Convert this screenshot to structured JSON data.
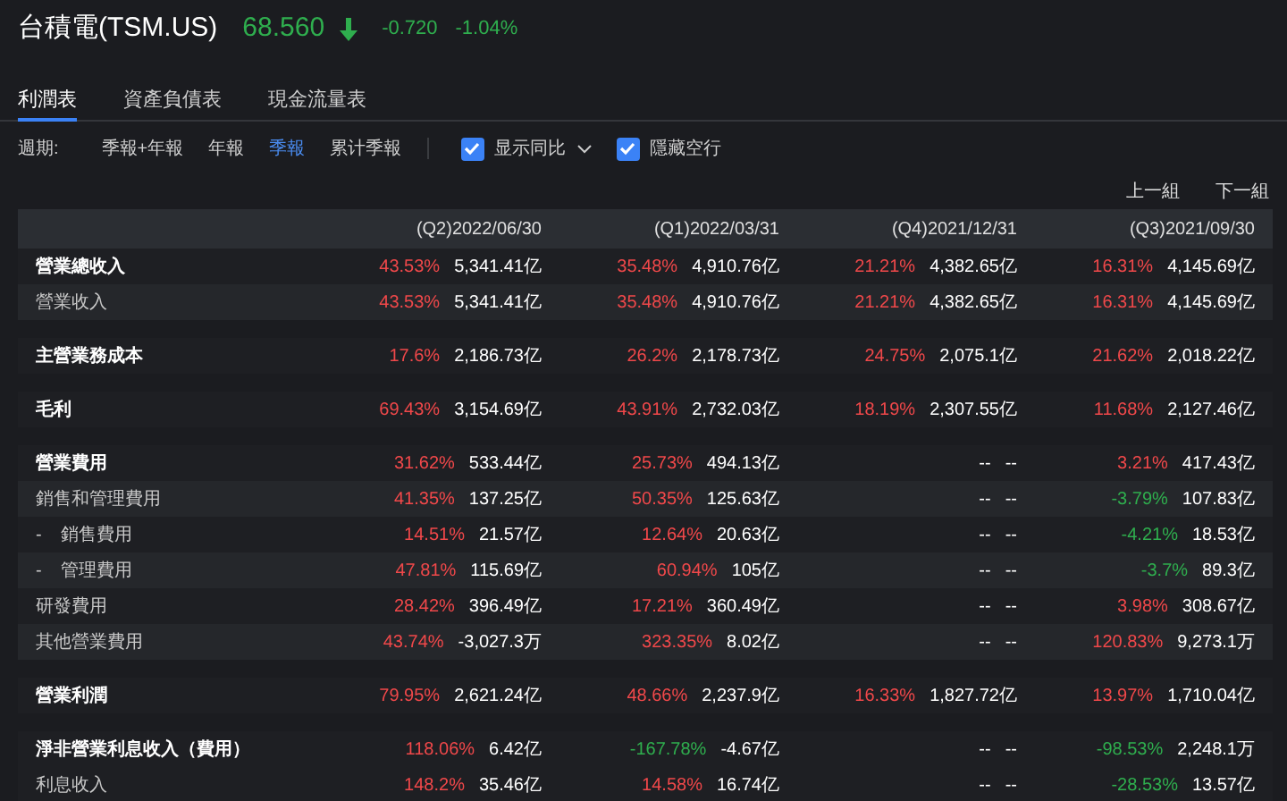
{
  "quote": {
    "name": "台積電(TSM.US)",
    "price": "68.560",
    "down": true,
    "change": "-0.720",
    "change_pct": "-1.04%"
  },
  "tabs": [
    {
      "label": "利潤表",
      "selected": true
    },
    {
      "label": "資產負債表",
      "selected": false
    },
    {
      "label": "現金流量表",
      "selected": false
    }
  ],
  "period": {
    "label": "週期:",
    "options": [
      {
        "label": "季報+年報",
        "selected": false
      },
      {
        "label": "年報",
        "selected": false
      },
      {
        "label": "季報",
        "selected": true
      },
      {
        "label": "累计季報",
        "selected": false
      }
    ]
  },
  "toggles": [
    {
      "label": "显示同比",
      "checked": true,
      "dropdown": true
    },
    {
      "label": "隱藏空行",
      "checked": true,
      "dropdown": false
    }
  ],
  "pager": [
    "上一組",
    "下一組"
  ],
  "table": {
    "columns": [
      "(Q2)2022/06/30",
      "(Q1)2022/03/31",
      "(Q4)2021/12/31",
      "(Q3)2021/09/30"
    ],
    "rows": [
      {
        "label": "營業總收入",
        "bold": true,
        "gap": false,
        "cells": [
          {
            "pct": "43.53%",
            "color": "#f0484a",
            "value": "5,341.41亿"
          },
          {
            "pct": "35.48%",
            "color": "#f0484a",
            "value": "4,910.76亿"
          },
          {
            "pct": "21.21%",
            "color": "#f0484a",
            "value": "4,382.65亿"
          },
          {
            "pct": "16.31%",
            "color": "#f0484a",
            "value": "4,145.69亿"
          }
        ]
      },
      {
        "label": "營業收入",
        "bold": false,
        "gap": false,
        "cells": [
          {
            "pct": "43.53%",
            "color": "#f0484a",
            "value": "5,341.41亿"
          },
          {
            "pct": "35.48%",
            "color": "#f0484a",
            "value": "4,910.76亿"
          },
          {
            "pct": "21.21%",
            "color": "#f0484a",
            "value": "4,382.65亿"
          },
          {
            "pct": "16.31%",
            "color": "#f0484a",
            "value": "4,145.69亿"
          }
        ]
      },
      {
        "label": "主營業務成本",
        "bold": true,
        "gap": true,
        "cells": [
          {
            "pct": "17.6%",
            "color": "#f0484a",
            "value": "2,186.73亿"
          },
          {
            "pct": "26.2%",
            "color": "#f0484a",
            "value": "2,178.73亿"
          },
          {
            "pct": "24.75%",
            "color": "#f0484a",
            "value": "2,075.1亿"
          },
          {
            "pct": "21.62%",
            "color": "#f0484a",
            "value": "2,018.22亿"
          }
        ]
      },
      {
        "label": "毛利",
        "bold": true,
        "gap": true,
        "cells": [
          {
            "pct": "69.43%",
            "color": "#f0484a",
            "value": "3,154.69亿"
          },
          {
            "pct": "43.91%",
            "color": "#f0484a",
            "value": "2,732.03亿"
          },
          {
            "pct": "18.19%",
            "color": "#f0484a",
            "value": "2,307.55亿"
          },
          {
            "pct": "11.68%",
            "color": "#f0484a",
            "value": "2,127.46亿"
          }
        ]
      },
      {
        "label": "營業費用",
        "bold": true,
        "gap": true,
        "cells": [
          {
            "pct": "31.62%",
            "color": "#f0484a",
            "value": "533.44亿"
          },
          {
            "pct": "25.73%",
            "color": "#f0484a",
            "value": "494.13亿"
          },
          {
            "pct": "--",
            "color": "#ffffff",
            "value": "--"
          },
          {
            "pct": "3.21%",
            "color": "#f0484a",
            "value": "417.43亿"
          }
        ]
      },
      {
        "label": "銷售和管理費用",
        "bold": false,
        "gap": false,
        "cells": [
          {
            "pct": "41.35%",
            "color": "#f0484a",
            "value": "137.25亿"
          },
          {
            "pct": "50.35%",
            "color": "#f0484a",
            "value": "125.63亿"
          },
          {
            "pct": "--",
            "color": "#ffffff",
            "value": "--"
          },
          {
            "pct": "-3.79%",
            "color": "#2fae4e",
            "value": "107.83亿"
          }
        ],
        "children": [
          {
            "label": "銷售費用",
            "bullet": "-",
            "cells": [
              {
                "pct": "14.51%",
                "color": "#f0484a",
                "value": "21.57亿"
              },
              {
                "pct": "12.64%",
                "color": "#f0484a",
                "value": "20.63亿"
              },
              {
                "pct": "--",
                "color": "#ffffff",
                "value": "--"
              },
              {
                "pct": "-4.21%",
                "color": "#2fae4e",
                "value": "18.53亿"
              }
            ]
          },
          {
            "label": "管理費用",
            "bullet": "-",
            "cells": [
              {
                "pct": "47.81%",
                "color": "#f0484a",
                "value": "115.69亿"
              },
              {
                "pct": "60.94%",
                "color": "#f0484a",
                "value": "105亿"
              },
              {
                "pct": "--",
                "color": "#ffffff",
                "value": "--"
              },
              {
                "pct": "-3.7%",
                "color": "#2fae4e",
                "value": "89.3亿"
              }
            ]
          }
        ]
      },
      {
        "label": "研發費用",
        "bold": false,
        "gap": false,
        "cells": [
          {
            "pct": "28.42%",
            "color": "#f0484a",
            "value": "396.49亿"
          },
          {
            "pct": "17.21%",
            "color": "#f0484a",
            "value": "360.49亿"
          },
          {
            "pct": "--",
            "color": "#ffffff",
            "value": "--"
          },
          {
            "pct": "3.98%",
            "color": "#f0484a",
            "value": "308.67亿"
          }
        ]
      },
      {
        "label": "其他營業費用",
        "bold": false,
        "gap": false,
        "cells": [
          {
            "pct": "43.74%",
            "color": "#f0484a",
            "value": "-3,027.3万"
          },
          {
            "pct": "323.35%",
            "color": "#f0484a",
            "value": "8.02亿"
          },
          {
            "pct": "--",
            "color": "#ffffff",
            "value": "--"
          },
          {
            "pct": "120.83%",
            "color": "#f0484a",
            "value": "9,273.1万"
          }
        ]
      },
      {
        "label": "營業利潤",
        "bold": true,
        "gap": true,
        "cells": [
          {
            "pct": "79.95%",
            "color": "#f0484a",
            "value": "2,621.24亿"
          },
          {
            "pct": "48.66%",
            "color": "#f0484a",
            "value": "2,237.9亿"
          },
          {
            "pct": "16.33%",
            "color": "#f0484a",
            "value": "1,827.72亿"
          },
          {
            "pct": "13.97%",
            "color": "#f0484a",
            "value": "1,710.04亿"
          }
        ]
      },
      {
        "label": "淨非營業利息收入（費用）",
        "bold": true,
        "gap": true,
        "cells": [
          {
            "pct": "118.06%",
            "color": "#f0484a",
            "value": "6.42亿"
          },
          {
            "pct": "-167.78%",
            "color": "#2fae4e",
            "value": "-4.67亿"
          },
          {
            "pct": "--",
            "color": "#ffffff",
            "value": "--"
          },
          {
            "pct": "-98.53%",
            "color": "#2fae4e",
            "value": "2,248.1万"
          }
        ]
      },
      {
        "label": "利息收入",
        "bold": false,
        "gap": false,
        "cells": [
          {
            "pct": "148.2%",
            "color": "#f0484a",
            "value": "35.46亿"
          },
          {
            "pct": "14.58%",
            "color": "#f0484a",
            "value": "16.74亿"
          },
          {
            "pct": "--",
            "color": "#ffffff",
            "value": "--"
          },
          {
            "pct": "-28.53%",
            "color": "#2fae4e",
            "value": "13.57亿"
          }
        ]
      }
    ]
  }
}
